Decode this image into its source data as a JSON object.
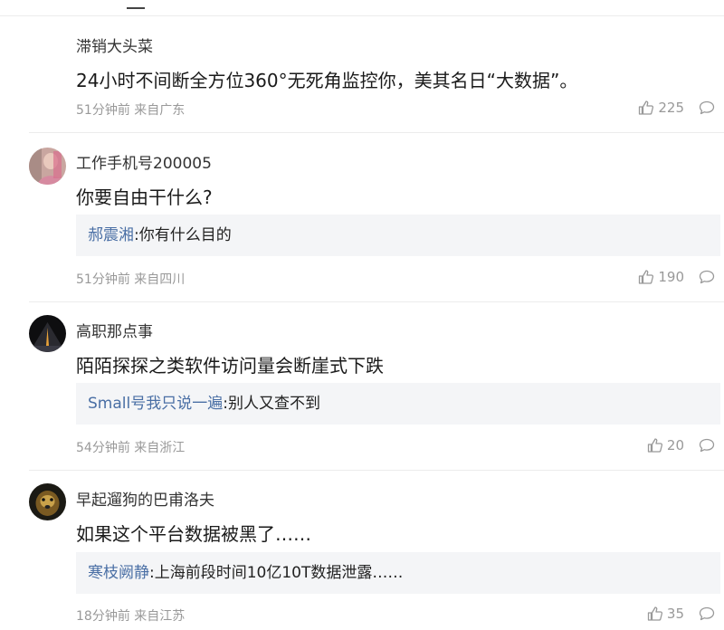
{
  "comments": [
    {
      "username": "滞销大头菜",
      "content": "24小时不间断全方位360°无死角监控你，美其名日“大数据”。",
      "time": "51分钟前",
      "location": "来自广东",
      "likes": "225"
    },
    {
      "username": "工作手机号200005",
      "content": "你要自由干什么?",
      "reply": {
        "name": "郝震湘",
        "text": ":你有什么目的"
      },
      "time": "51分钟前",
      "location": "来自四川",
      "likes": "190"
    },
    {
      "username": "高职那点事",
      "content": "陌陌探探之类软件访问量会断崖式下跌",
      "reply": {
        "name": "Small号我只说一遍",
        "text": ":别人又查不到"
      },
      "time": "54分钟前",
      "location": "来自浙江",
      "likes": "20"
    },
    {
      "username": "早起遛狗的巴甫洛夫",
      "content": "如果这个平台数据被黑了……",
      "reply": {
        "name": "寒枝阙静",
        "text": ":上海前段时间10亿10T数据泄露……"
      },
      "time": "18分钟前",
      "location": "来自江苏",
      "likes": "35"
    }
  ],
  "icons": {
    "like": "thumbs-up-icon",
    "comment": "comment-bubble-icon"
  },
  "colors": {
    "reply_name": "#4a6fa5",
    "meta_text": "#999999",
    "reply_bg": "#f4f5f7"
  }
}
